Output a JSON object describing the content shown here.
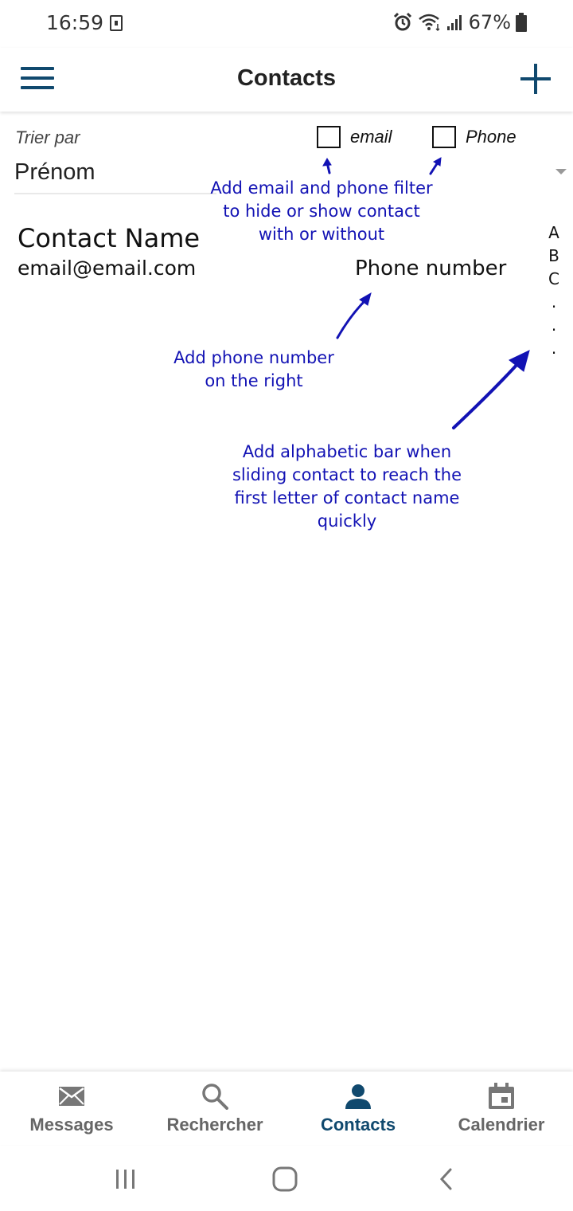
{
  "status": {
    "time": "16:59",
    "battery": "67%"
  },
  "header": {
    "title": "Contacts"
  },
  "sort": {
    "label": "Trier par",
    "value": "Prénom"
  },
  "filters": {
    "email_label": "email",
    "phone_label": "Phone"
  },
  "notes": {
    "filter": [
      "Add email and phone filter",
      "to hide or show contact",
      "with or without"
    ],
    "phone": [
      "Add phone number",
      "on the right"
    ],
    "alpha": [
      "Add alphabetic bar when",
      "sliding contact to reach the",
      "first letter of contact name",
      "quickly"
    ]
  },
  "contact": {
    "name": "Contact Name",
    "email": "email@email.com",
    "phone": "Phone number"
  },
  "alphabet": [
    "A",
    "B",
    "C",
    ".",
    ".",
    "."
  ],
  "nav": {
    "items": [
      {
        "label": "Messages",
        "icon": "envelope-icon"
      },
      {
        "label": "Rechercher",
        "icon": "search-icon"
      },
      {
        "label": "Contacts",
        "icon": "person-icon"
      },
      {
        "label": "Calendrier",
        "icon": "calendar-icon"
      }
    ],
    "active": "Contacts"
  },
  "colors": {
    "brand": "#10496e",
    "annotation": "#1212b4"
  }
}
